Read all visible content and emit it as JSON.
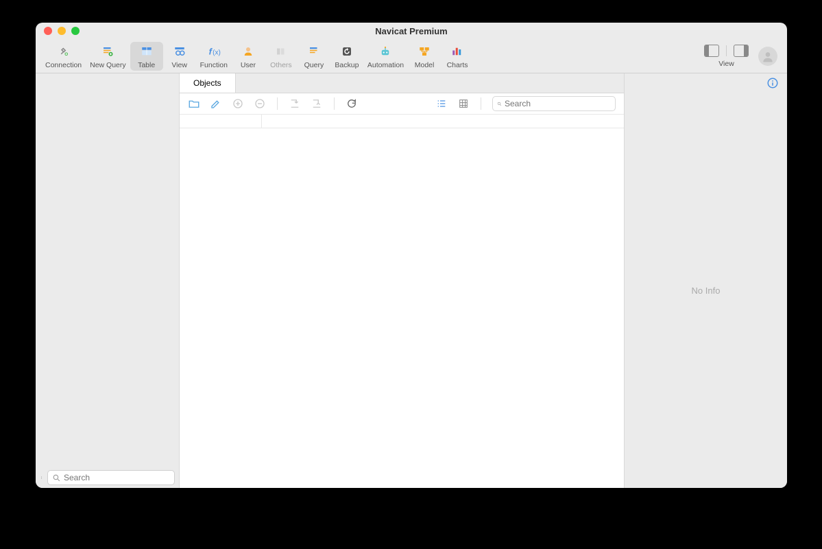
{
  "title": "Navicat Premium",
  "toolbar": [
    {
      "id": "connection",
      "label": "Connection"
    },
    {
      "id": "new-query",
      "label": "New Query"
    },
    {
      "id": "table",
      "label": "Table",
      "active": true
    },
    {
      "id": "view",
      "label": "View"
    },
    {
      "id": "function",
      "label": "Function"
    },
    {
      "id": "user",
      "label": "User"
    },
    {
      "id": "others",
      "label": "Others",
      "disabled": true
    },
    {
      "id": "query",
      "label": "Query"
    },
    {
      "id": "backup",
      "label": "Backup"
    },
    {
      "id": "automation",
      "label": "Automation"
    },
    {
      "id": "model",
      "label": "Model"
    },
    {
      "id": "charts",
      "label": "Charts"
    }
  ],
  "toolbar_right_label": "View",
  "tabs": [
    {
      "label": "Objects"
    }
  ],
  "obj_search_placeholder": "Search",
  "sidebar_search_placeholder": "Search",
  "right_panel": {
    "no_info": "No Info"
  }
}
